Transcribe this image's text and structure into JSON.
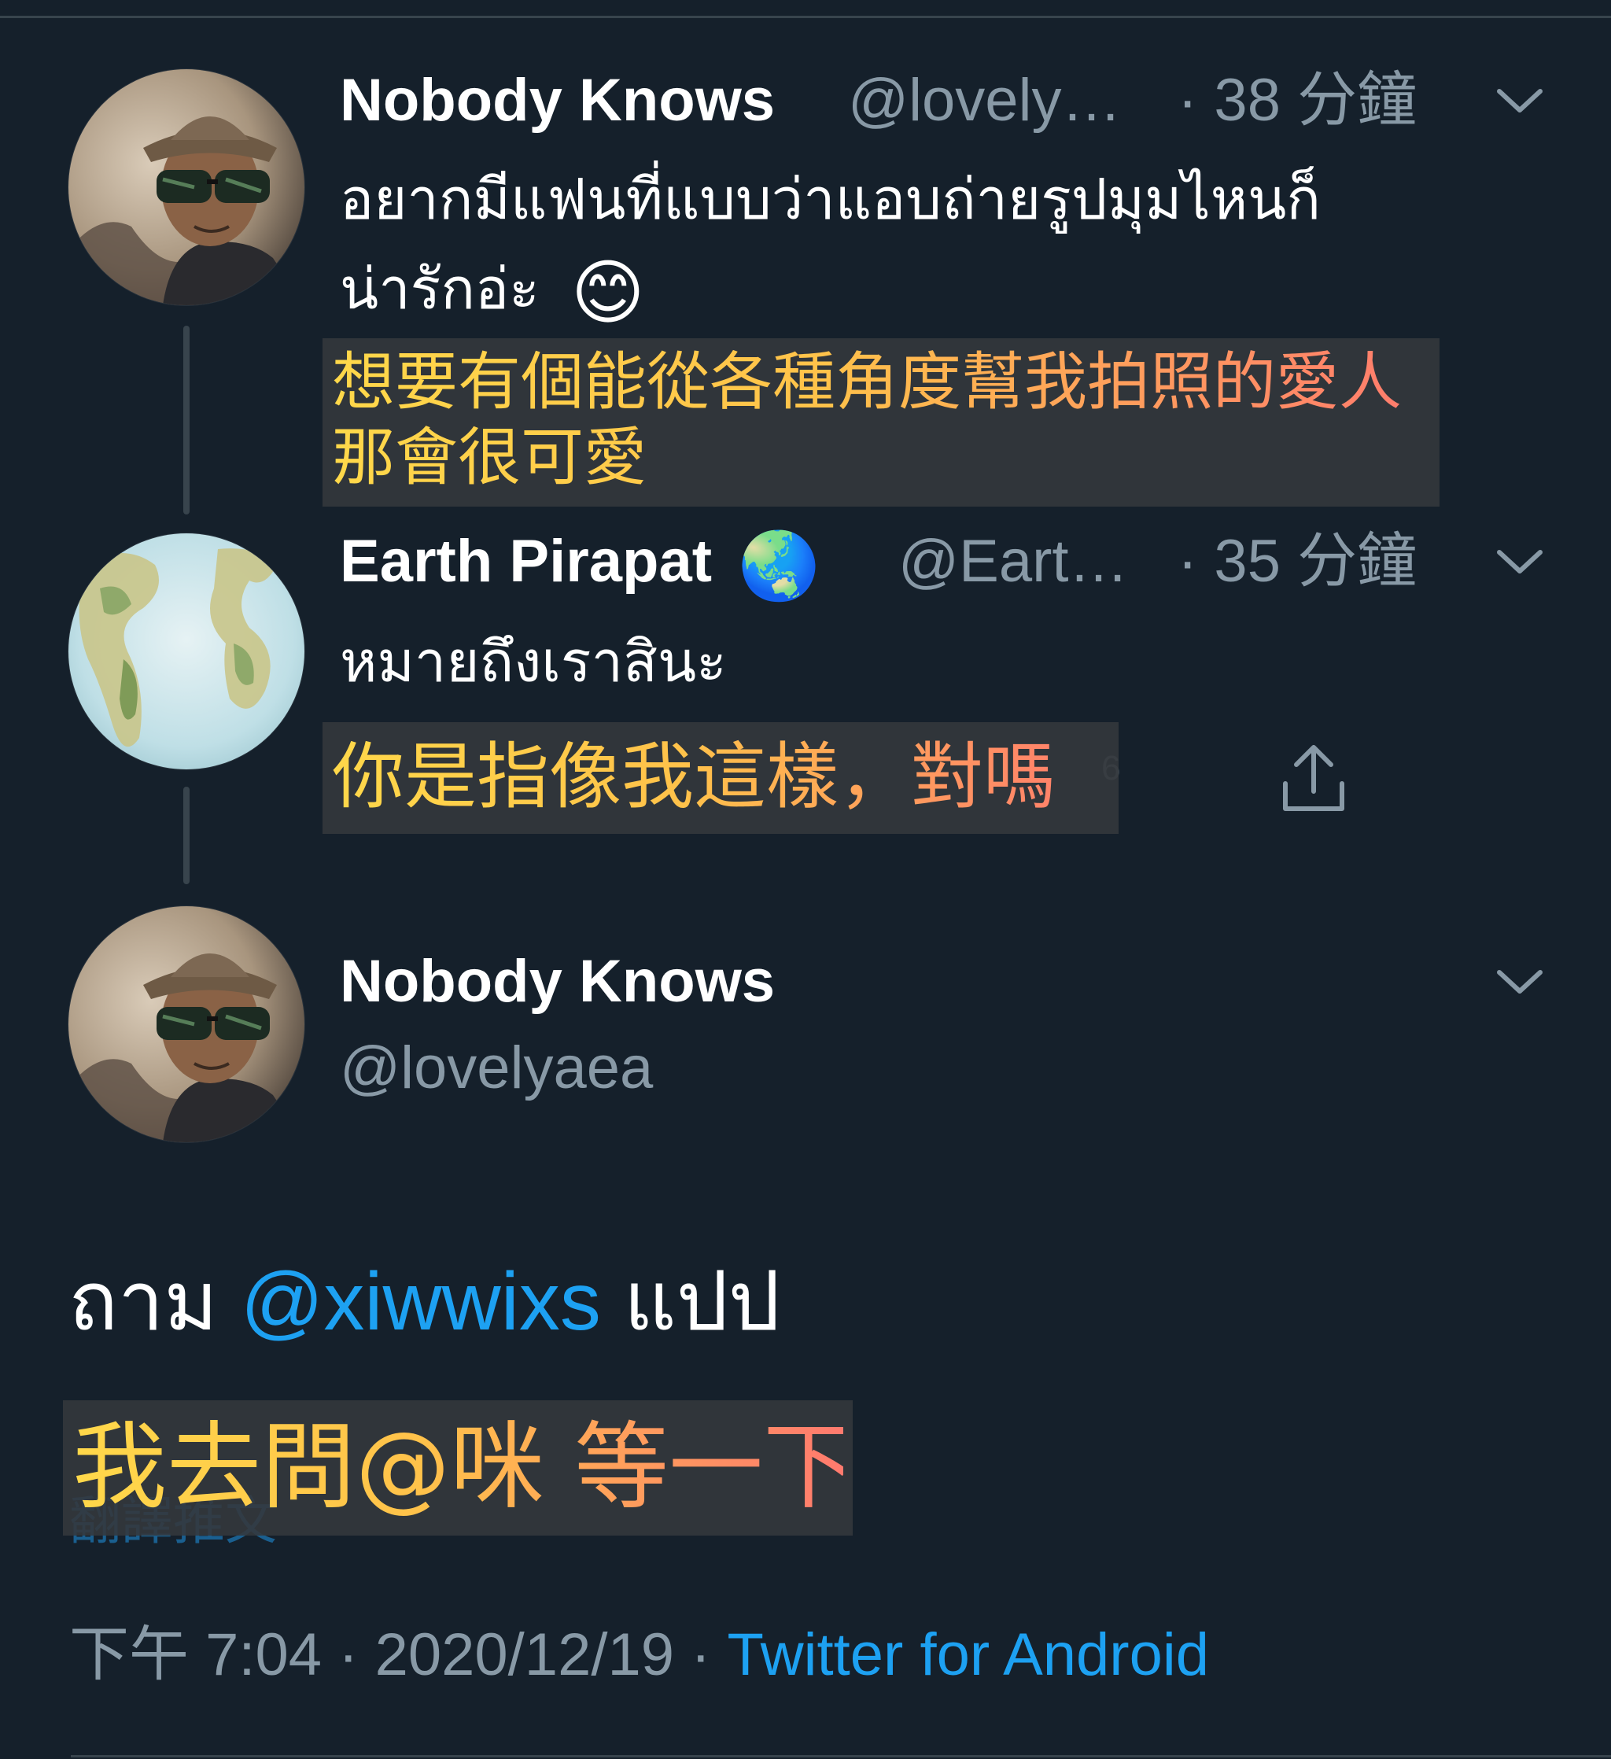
{
  "tweets": [
    {
      "author_name": "Nobody Knows",
      "author_handle": "@lovely…",
      "time": "· 38 分鐘",
      "text_line1": "อยากมีแฟนที่แบบว่าแอบถ่ายรูปมุมไหนก็",
      "text_line2": "น่ารักอ่ะ",
      "emoji": "😊",
      "caption_line1": "想要有個能從各種角度幫我拍照的愛人",
      "caption_line2": "那會很可愛"
    },
    {
      "author_name": "Earth Pirapat",
      "author_emoji": "🌏",
      "author_handle": "@Eart…",
      "time": "· 35 分鐘",
      "text": "หมายถึงเราสินะ",
      "caption": "你是指像我這樣，對嗎",
      "ghost_count": "6"
    }
  ],
  "main_tweet": {
    "author_name": "Nobody Knows",
    "author_handle": "@lovelyaea",
    "text_prefix": "ถาม",
    "mention": "@xiwwixs",
    "text_suffix": "แปป",
    "caption": "我去問@咪 等一下",
    "translate_label": "翻譯推文",
    "time": "下午 7:04",
    "separator": "·",
    "date": "2020/12/19",
    "source": "Twitter for Android"
  },
  "icons": {
    "chevron": "chevron-down-icon",
    "share": "share-icon"
  },
  "colors": {
    "background": "#15202b",
    "muted": "#8899a6",
    "accent": "#1da1f2",
    "divider": "#38444d"
  }
}
